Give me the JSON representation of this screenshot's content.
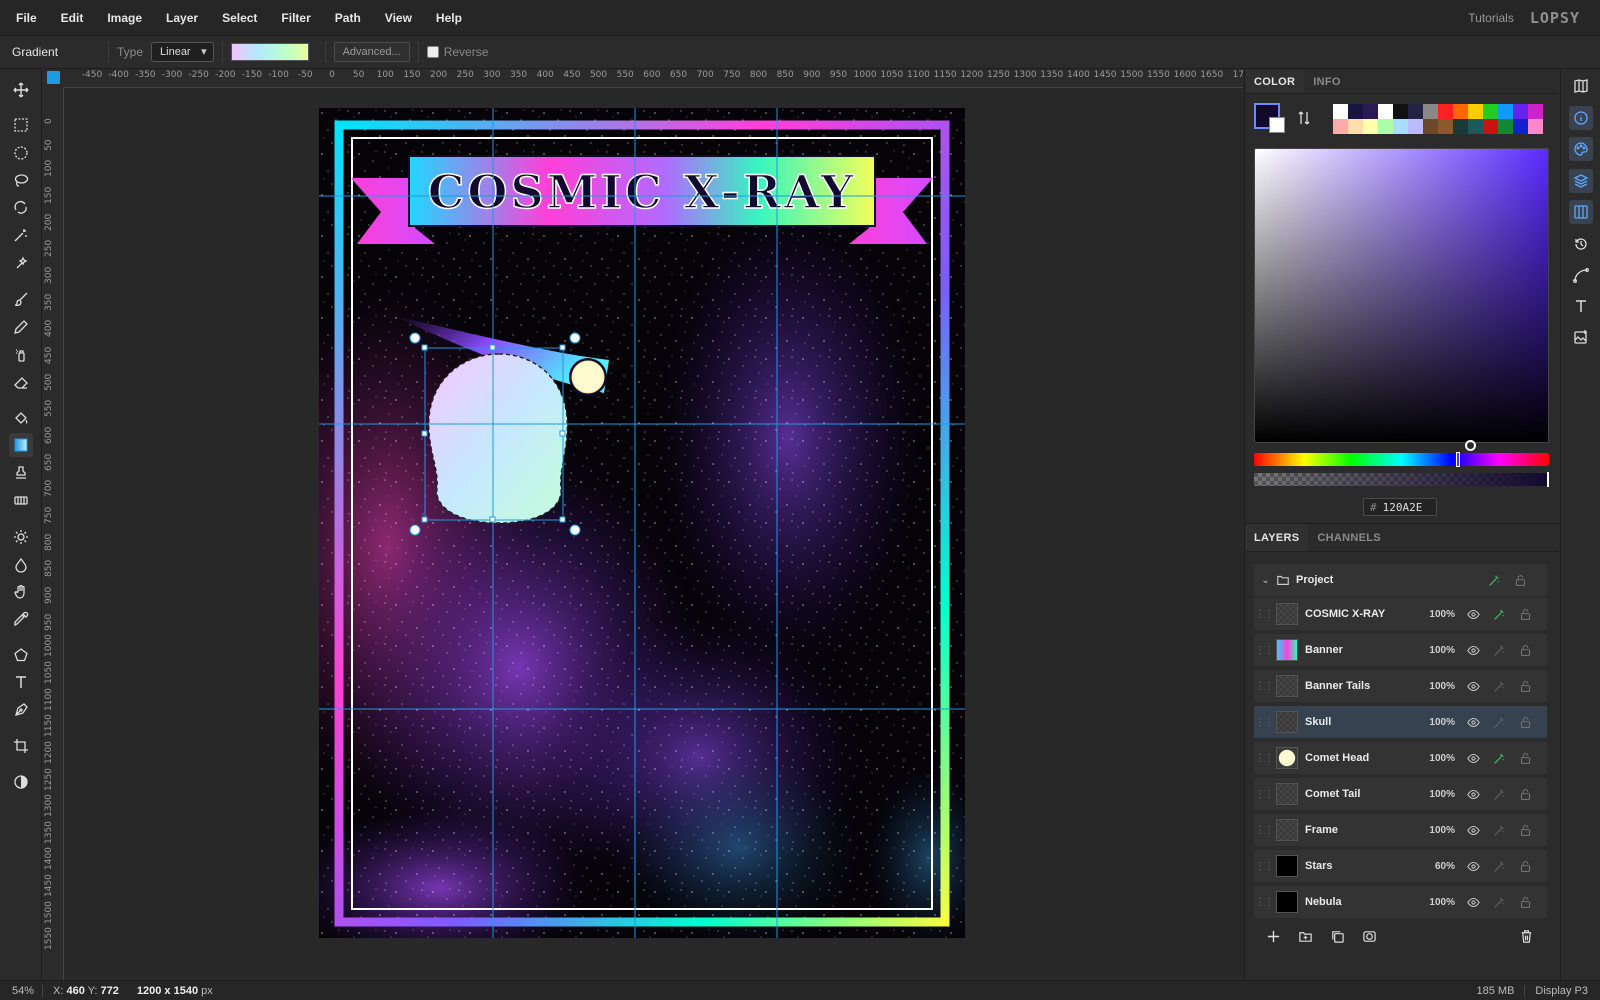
{
  "menubar": {
    "items": [
      "File",
      "Edit",
      "Image",
      "Layer",
      "Select",
      "Filter",
      "Path",
      "View",
      "Help"
    ],
    "tutorials": "Tutorials",
    "logo": "LOPSY"
  },
  "options": {
    "tool_name": "Gradient",
    "type_label": "Type",
    "type_value": "Linear",
    "advanced_label": "Advanced...",
    "reverse_label": "Reverse",
    "reverse_checked": false
  },
  "rulers": {
    "top": [
      "-450",
      "-400",
      "-350",
      "-300",
      "-250",
      "-200",
      "-150",
      "-100",
      "-50",
      "0",
      "50",
      "100",
      "150",
      "200",
      "250",
      "300",
      "350",
      "400",
      "450",
      "500",
      "550",
      "600",
      "650",
      "700",
      "750",
      "800",
      "850",
      "900",
      "950",
      "1000",
      "1050",
      "1100",
      "1150",
      "1200",
      "1250",
      "1300",
      "1350",
      "1400",
      "1450",
      "1500",
      "1550",
      "1600",
      "1650",
      "17"
    ],
    "left": [
      "0",
      "50",
      "100",
      "150",
      "200",
      "250",
      "300",
      "350",
      "400",
      "450",
      "500",
      "550",
      "600",
      "650",
      "700",
      "750",
      "800",
      "850",
      "900",
      "950",
      "1000",
      "1050",
      "1100",
      "1150",
      "1200",
      "1250",
      "1300",
      "1350",
      "1400",
      "1450",
      "1500",
      "1550"
    ]
  },
  "document": {
    "title_text": "COSMIC X-RAY"
  },
  "color_panel": {
    "tabs": [
      "COLOR",
      "INFO"
    ],
    "active_tab": "COLOR",
    "foreground": "#120a2e",
    "background": "#ffffff",
    "hex_value": "120A2E",
    "swatches": [
      "#ffffff",
      "#1a1440",
      "#2a1a55",
      "#ffffff",
      "#111111",
      "#222244",
      "#888888",
      "#ff2222",
      "#ff6600",
      "#ffcc00",
      "#22cc22",
      "#1199ff",
      "#6622ee",
      "#cc22cc",
      "#ffaaaa",
      "#ffddaa",
      "#ffffaa",
      "#aaffaa",
      "#aaddff",
      "#bbbbff",
      "#6a4a2a",
      "#8a5a2a",
      "#1a3a3a",
      "#1a5a5a",
      "#cc1111",
      "#118833",
      "#1122cc",
      "#ff88cc"
    ]
  },
  "layers_panel": {
    "tabs": [
      "LAYERS",
      "CHANNELS"
    ],
    "active_tab": "LAYERS",
    "group_name": "Project",
    "layers": [
      {
        "name": "COSMIC X-RAY",
        "opacity": "100%",
        "fx": true,
        "selected": false
      },
      {
        "name": "Banner",
        "opacity": "100%",
        "fx": false,
        "selected": false
      },
      {
        "name": "Banner Tails",
        "opacity": "100%",
        "fx": false,
        "selected": false
      },
      {
        "name": "Skull",
        "opacity": "100%",
        "fx": false,
        "selected": true
      },
      {
        "name": "Comet Head",
        "opacity": "100%",
        "fx": true,
        "selected": false
      },
      {
        "name": "Comet Tail",
        "opacity": "100%",
        "fx": false,
        "selected": false
      },
      {
        "name": "Frame",
        "opacity": "100%",
        "fx": false,
        "selected": false
      },
      {
        "name": "Stars",
        "opacity": "60%",
        "fx": false,
        "selected": false
      },
      {
        "name": "Nebula",
        "opacity": "100%",
        "fx": false,
        "selected": false
      }
    ]
  },
  "status": {
    "zoom": "54%",
    "x_label": "X:",
    "x_value": "460",
    "y_label": "Y:",
    "y_value": "772",
    "doc_size": "1200 x 1540",
    "doc_unit": "px",
    "memory": "185 MB",
    "profile": "Display P3"
  },
  "colors": {
    "accent": "#1a9be2",
    "selected_row": "#364250",
    "fx_green": "#3fcf6f"
  }
}
